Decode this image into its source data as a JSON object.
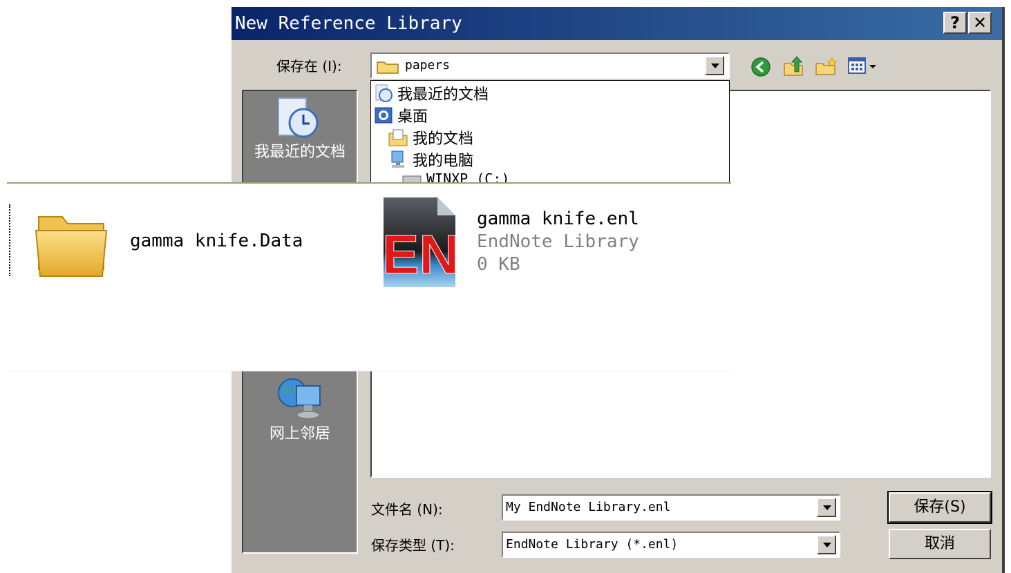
{
  "dialog": {
    "title": "New Reference Library",
    "help_label": "?",
    "close_label": "✕"
  },
  "savein": {
    "label": "保存在 (I):",
    "value": "papers",
    "options": [
      "我最近的文档",
      "桌面",
      "我的文档",
      "我的电脑",
      "WINXP (C:)"
    ]
  },
  "places": {
    "items": [
      "我最近的文档",
      "网上邻居"
    ]
  },
  "filelist": {
    "items": [
      {
        "name": "gamma knife.Data"
      },
      {
        "name": "gamma knife.enl",
        "type": "EndNote Library",
        "size": "0 KB"
      }
    ]
  },
  "fields": {
    "filename_label": "文件名 (N):",
    "filename_value": "My EndNote Library.enl",
    "filetype_label": "保存类型 (T):",
    "filetype_value": "EndNote Library (*.enl)"
  },
  "buttons": {
    "save": "保存(S)",
    "cancel": "取消"
  },
  "icons": {
    "logo_text": "EN"
  }
}
